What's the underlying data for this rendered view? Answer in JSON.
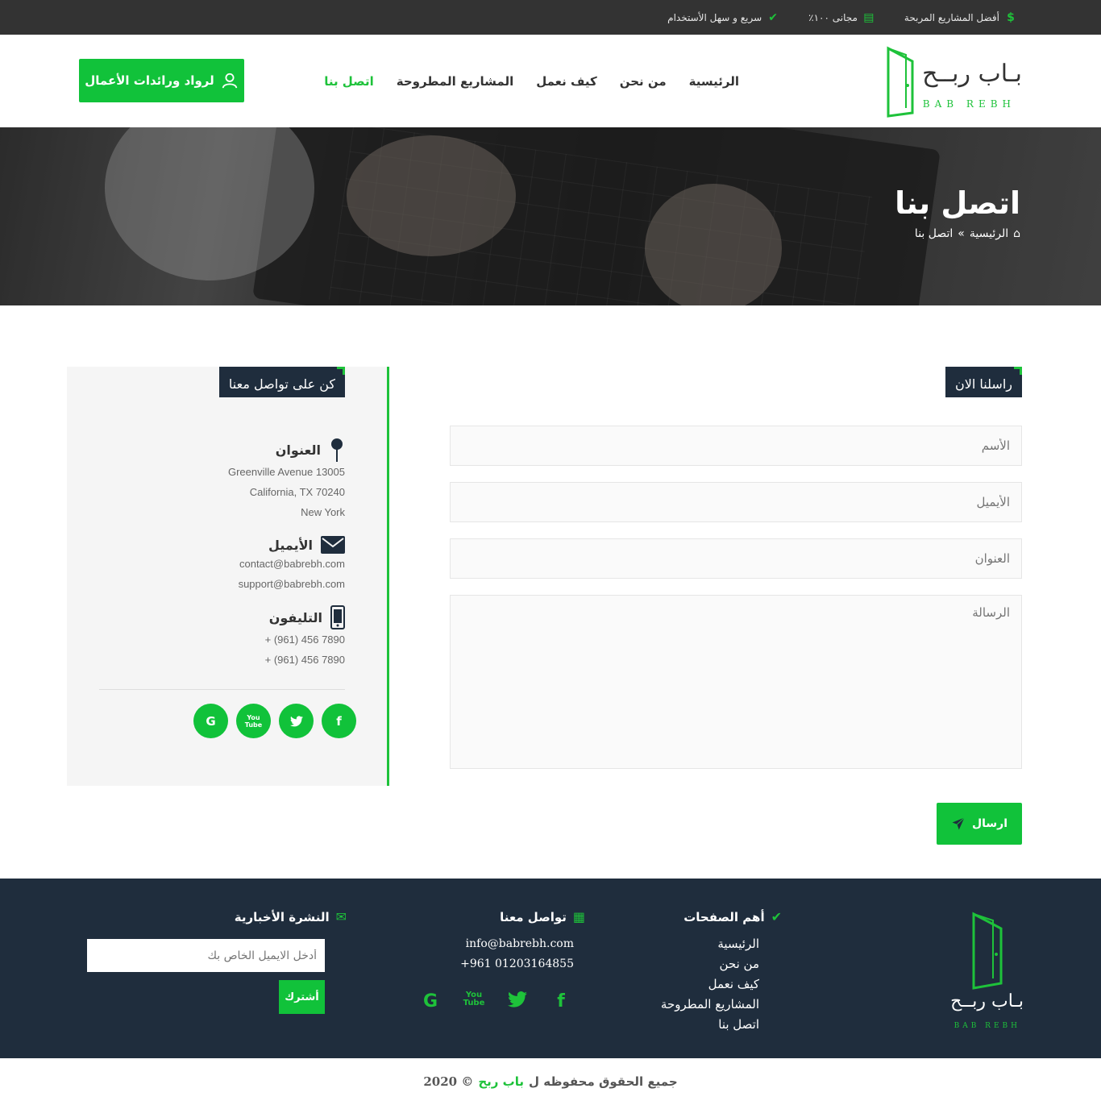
{
  "colors": {
    "accent": "#1ec23a",
    "dark": "#1f2d3d",
    "topbar": "#333333"
  },
  "topbar": {
    "items": [
      {
        "icon": "dollar-icon",
        "label": "أفضل المشاريع المربحة"
      },
      {
        "icon": "money-icon",
        "label": "مجانى ١٠٠٪"
      },
      {
        "icon": "check-circle-icon",
        "label": "سريع و سهل الأستخدام"
      }
    ]
  },
  "logo": {
    "ar": "بـاب ربــح",
    "en": "BAB REBH"
  },
  "nav": {
    "items": [
      "الرئيسية",
      "من نحن",
      "كيف نعمل",
      "المشاريع المطروحة",
      "اتصل بنا"
    ],
    "active": "اتصل بنا"
  },
  "cta": {
    "label": "لرواد ورائدات الأعمال",
    "icon": "user-icon"
  },
  "hero": {
    "title": "اتصل بنا",
    "breadcrumb": {
      "home": "الرئيسية",
      "sep": "»",
      "current": "اتصل بنا"
    }
  },
  "contact_info": {
    "title": "كن على تواصل معنا",
    "address": {
      "label": "العنوان",
      "lines": [
        "Greenville Avenue 13005",
        "California, TX 70240",
        "New York"
      ]
    },
    "email": {
      "label": "الأيميل",
      "lines": [
        "contact@babrebh.com",
        "support@babrebh.com"
      ]
    },
    "phone": {
      "label": "التليفون",
      "lines": [
        "+ (961) 456 7890",
        "+ (961) 456 7890"
      ]
    },
    "socials": [
      "f",
      "twitter",
      "You Tube",
      "G"
    ]
  },
  "form": {
    "title": "راسلنا الان",
    "name_placeholder": "الأسم",
    "email_placeholder": "الأيميل",
    "address_placeholder": "العنوان",
    "message_placeholder": "الرسالة",
    "send_label": "ارسال"
  },
  "footer": {
    "logo": {
      "ar": "بـاب ربــح",
      "en": "BAB REBH"
    },
    "pages": {
      "title": "أهم الصفحات",
      "links": [
        "الرئيسية",
        "من نحن",
        "كيف نعمل",
        "المشاريع المطروحة",
        "اتصل بنا"
      ]
    },
    "contact": {
      "title": "تواصل معنا",
      "email": "info@babrebh.com",
      "phone": "+961 01203164855"
    },
    "newsletter": {
      "title": "النشرة الأخبارية",
      "placeholder": "أدخل الايميل الخاص بك",
      "button": "أشترك"
    }
  },
  "copyright": {
    "prefix": "جميع الحقوق محفوظه ل",
    "brand": "باب ربح",
    "suffix": "© 2020"
  }
}
